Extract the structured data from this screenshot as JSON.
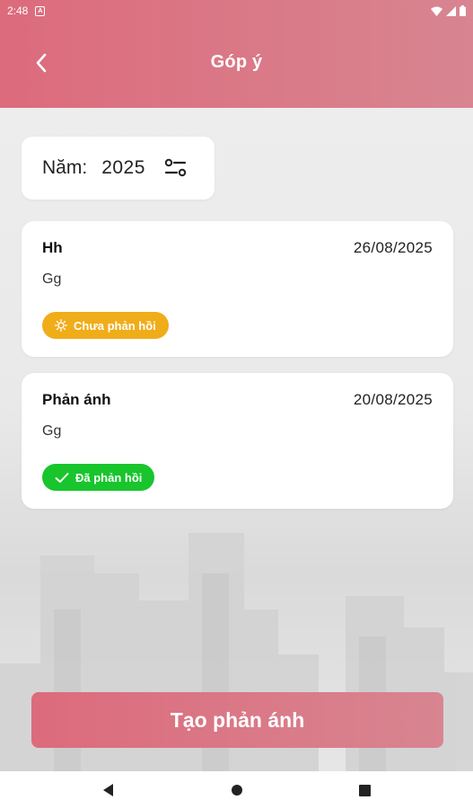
{
  "status_bar": {
    "time": "2:48",
    "notification_icon": "A"
  },
  "header": {
    "title": "Góp ý",
    "back_icon": "chevron-left-icon"
  },
  "filter": {
    "label": "Năm:",
    "year": "2025",
    "icon": "sliders-icon"
  },
  "feedback_items": [
    {
      "title": "Hh",
      "date": "26/08/2025",
      "content": "Gg",
      "status": "Chưa phản hồi",
      "status_color": "#f0ad1a",
      "status_icon": "sun-icon"
    },
    {
      "title": "Phản ánh",
      "date": "20/08/2025",
      "content": "Gg",
      "status": "Đã phản hồi",
      "status_color": "#18c52c",
      "status_icon": "check-icon"
    }
  ],
  "create_button": {
    "label": "Tạo phản ánh"
  },
  "colors": {
    "brand_start": "#dc6b7c",
    "brand_end": "#d88591"
  }
}
